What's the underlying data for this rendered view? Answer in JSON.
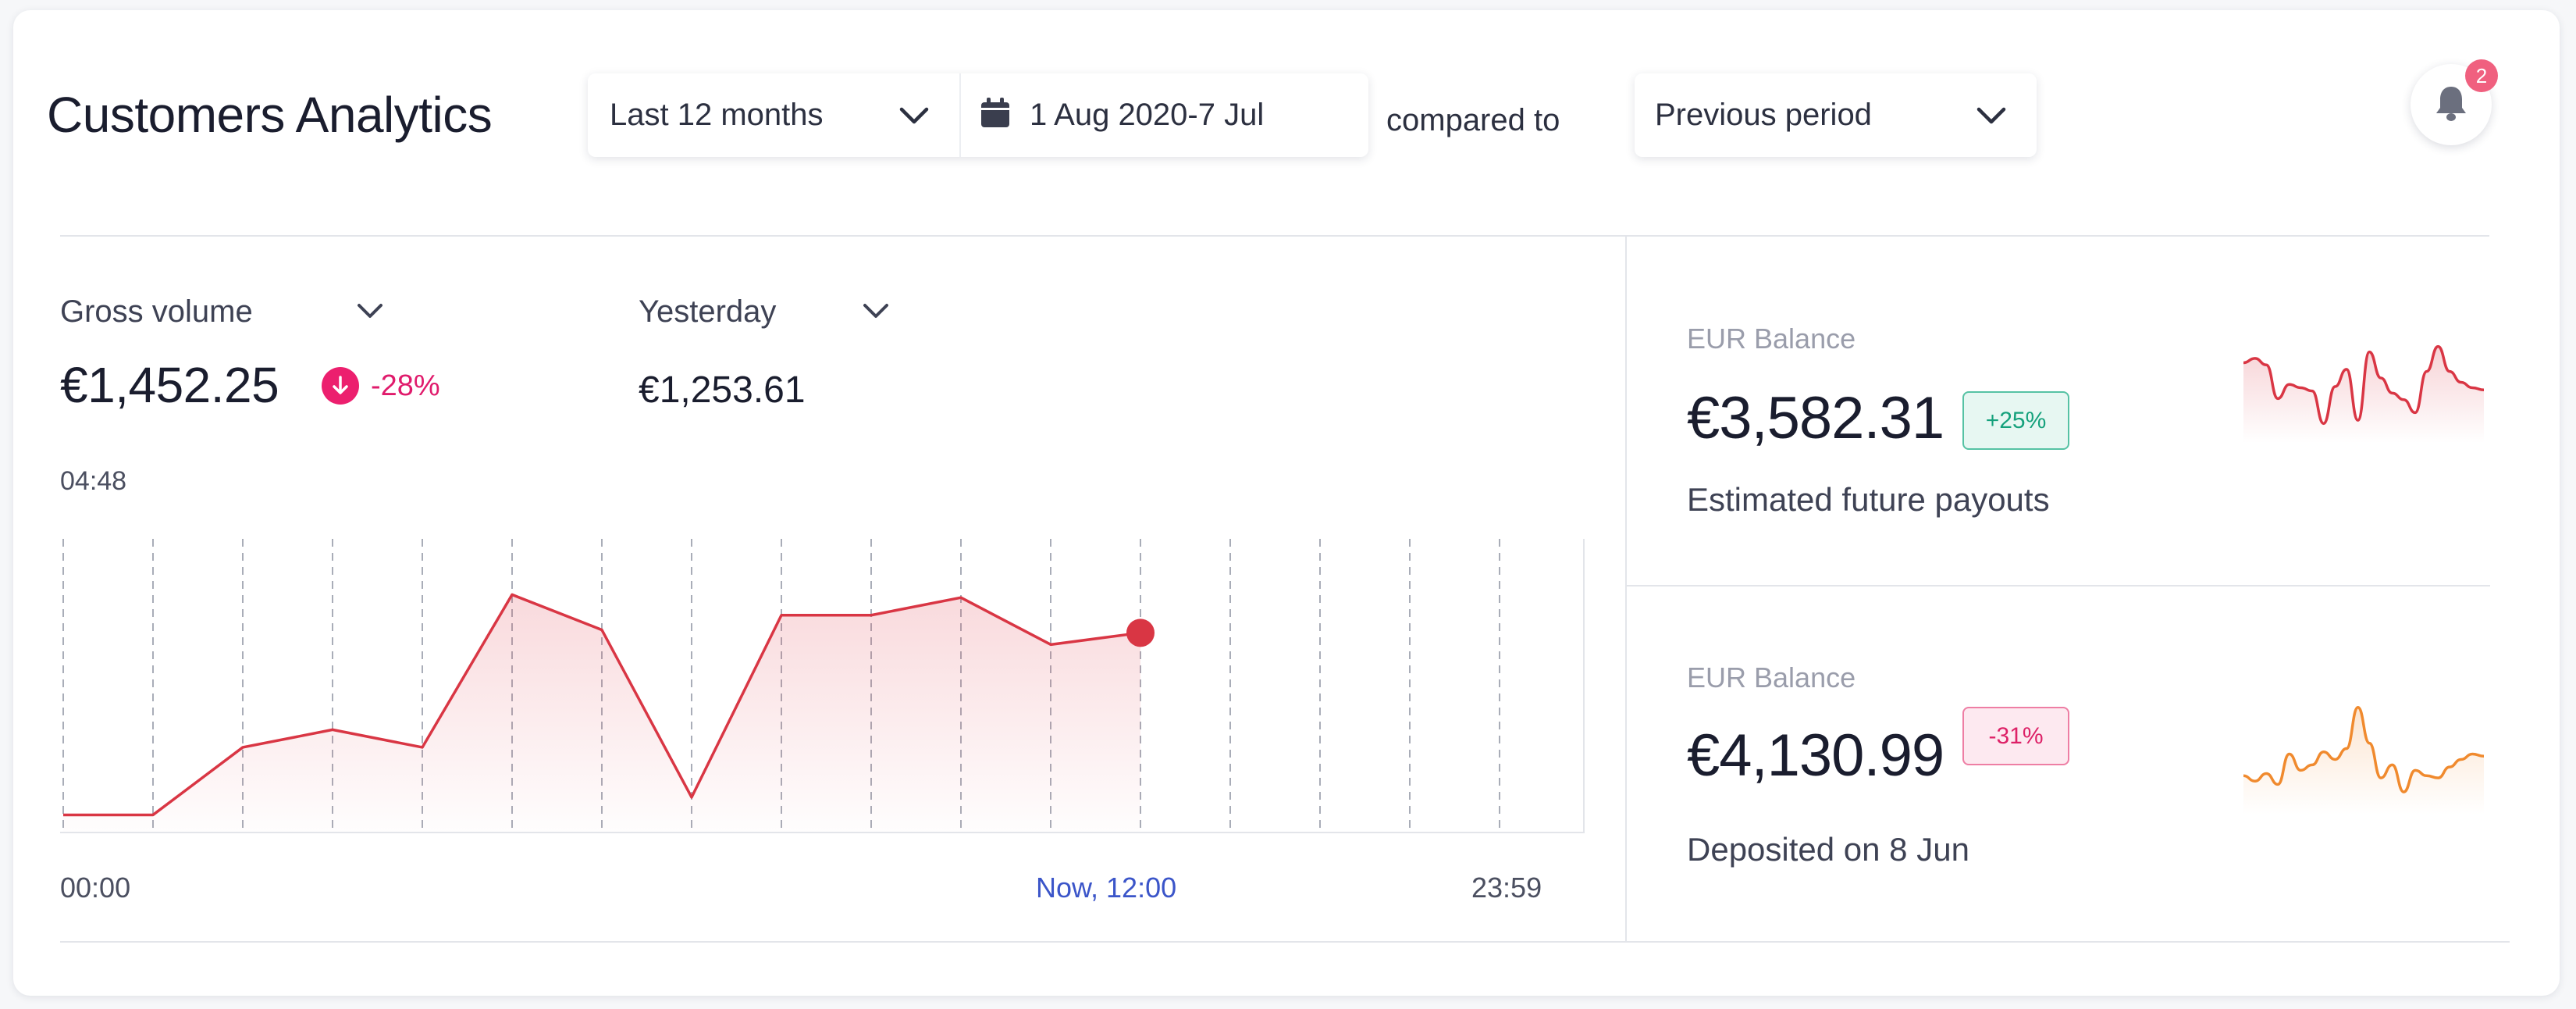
{
  "header": {
    "title": "Customers Analytics",
    "range_select": "Last 12 months",
    "date_range": "1 Aug 2020-7 Jul",
    "compared_to": "compared to",
    "compare_select": "Previous period",
    "notifications_count": "2"
  },
  "metrics": {
    "gross_volume": {
      "label": "Gross volume",
      "value": "€1,452.25",
      "change": "-28%"
    },
    "yesterday": {
      "label": "Yesterday",
      "value": "€1,253.61"
    }
  },
  "chart": {
    "time_top": "04:48",
    "axis_start": "00:00",
    "axis_now": "Now, 12:00",
    "axis_end": "23:59"
  },
  "chart_data": {
    "type": "area",
    "title": "",
    "xlabel": "",
    "ylabel": "",
    "x": [
      0,
      1,
      2,
      3,
      4,
      5,
      6,
      7,
      8,
      9,
      10,
      11,
      12
    ],
    "series": [
      {
        "values": [
          6,
          6,
          29,
          35,
          29,
          81,
          69,
          12,
          74,
          74,
          80,
          64,
          68
        ]
      }
    ],
    "ylim": [
      0,
      100
    ],
    "color": "#d93644",
    "grid": "vertical dashed"
  },
  "balances": [
    {
      "label": "EUR Balance",
      "value": "€3,582.31",
      "change": "+25%",
      "description": "Estimated future payouts",
      "color": "#d93644",
      "spark": [
        68,
        72,
        66,
        35,
        48,
        45,
        42,
        12,
        46,
        62,
        15,
        78,
        54,
        40,
        34,
        22,
        60,
        83,
        60,
        50,
        45,
        43
      ]
    },
    {
      "label": "EUR Balance",
      "value": "€4,130.99",
      "change": "-31%",
      "description": "Deposited on 8 Jun",
      "color": "#f08a2e",
      "spark": [
        30,
        25,
        32,
        22,
        50,
        35,
        40,
        52,
        45,
        55,
        93,
        60,
        28,
        40,
        15,
        35,
        30,
        28,
        38,
        45,
        50,
        48
      ]
    }
  ],
  "colors": {
    "accent_red": "#d93644",
    "accent_orange": "#f08a2e",
    "negative": "#ec1f6e",
    "positive": "#15a17c",
    "link": "#3b55c9"
  }
}
